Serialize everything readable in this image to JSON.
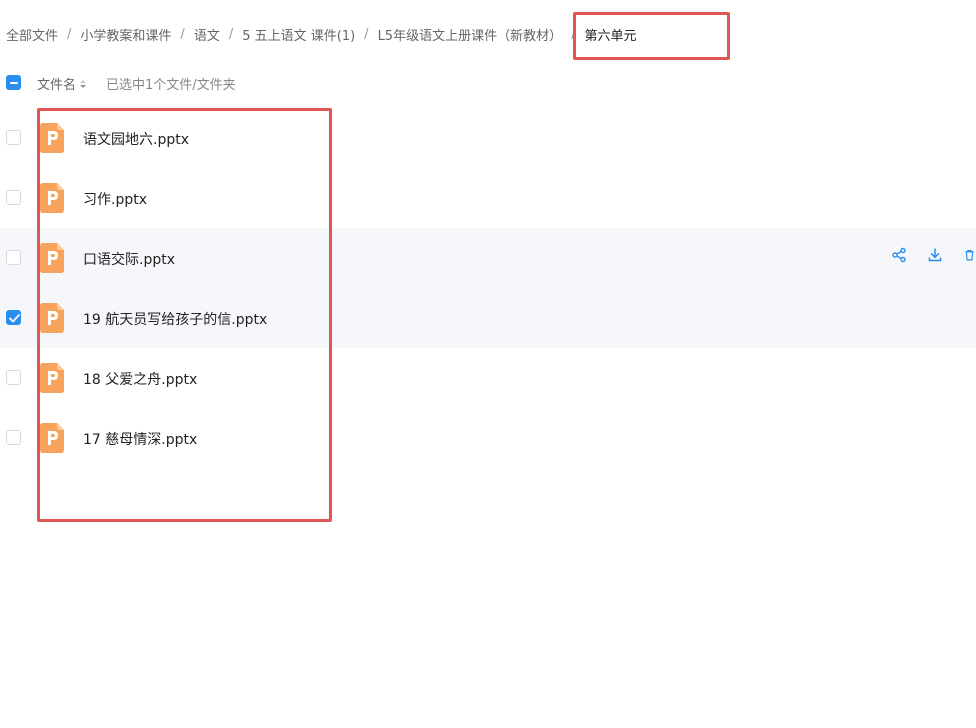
{
  "breadcrumb": {
    "items": [
      "全部文件",
      "小学教案和课件",
      "语文",
      "5 五上语文 课件(1)",
      "L5年级语文上册课件（新教材）",
      "第六单元"
    ],
    "separator": "/"
  },
  "list_header": {
    "column_name": "文件名",
    "selection_info": "已选中1个文件/文件夹"
  },
  "files": [
    {
      "name": "语文园地六.pptx",
      "checked": false
    },
    {
      "name": "习作.pptx",
      "checked": false
    },
    {
      "name": "口语交际.pptx",
      "checked": false
    },
    {
      "name": "19 航天员写给孩子的信.pptx",
      "checked": true
    },
    {
      "name": "18 父爱之舟.pptx",
      "checked": false
    },
    {
      "name": "17 慈母情深.pptx",
      "checked": false
    }
  ],
  "row_actions": [
    "share-icon",
    "download-icon",
    "delete-icon"
  ],
  "colors": {
    "accent": "#2a8ef0",
    "ppt_icon": "#f7a35c",
    "annotation": "#e05555",
    "row_highlight": "#f5f7fa"
  }
}
